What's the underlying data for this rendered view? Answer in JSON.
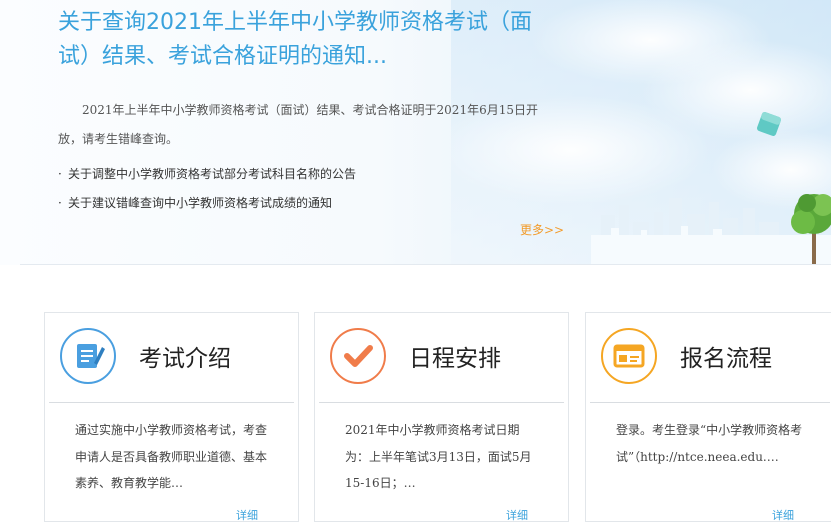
{
  "news": {
    "title": "关于查询2021年上半年中小学教师资格考试（面试）结果、考试合格证明的通知...",
    "summary": "2021年上半年中小学教师资格考试（面试）结果、考试合格证明于2021年6月15日开放，请考生错峰查询。",
    "list": [
      "关于调整中小学教师资格考试部分考试科目名称的公告",
      "关于建议错峰查询中小学教师资格考试成绩的通知"
    ],
    "more": "更多>>"
  },
  "cards": [
    {
      "title": "考试介绍",
      "text": "通过实施中小学教师资格考试，考查申请人是否具备教师职业道德、基本素养、教育教学能…",
      "more": "详细",
      "icon": "document-pen-icon",
      "color": "#4a9fe0"
    },
    {
      "title": "日程安排",
      "text": "2021年中小学教师资格考试日期为：上半年笔试3月13日，面试5月15-16日；…",
      "more": "详细",
      "icon": "checkmark-icon",
      "color": "#f07c4a"
    },
    {
      "title": "报名流程",
      "text": "登录。考生登录“中小学教师资格考试”（http://ntce.neea.edu.…",
      "more": "详细",
      "icon": "registration-card-icon",
      "color": "#f5a623"
    }
  ]
}
